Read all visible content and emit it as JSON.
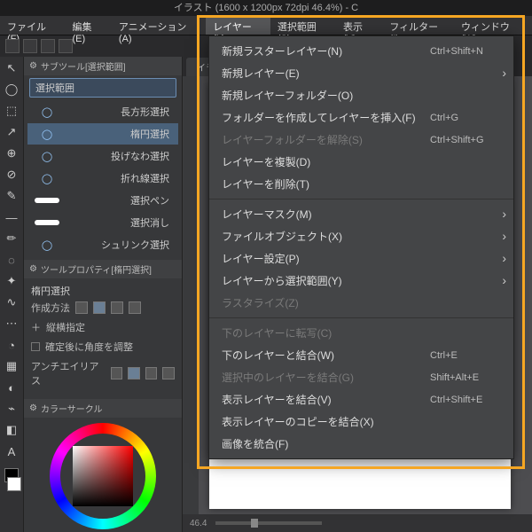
{
  "title": "イラスト (1600 x 1200px 72dpi 46.4%) - C",
  "menubar": [
    {
      "label": "ファイル(F)"
    },
    {
      "label": "編集(E)"
    },
    {
      "label": "アニメーション(A)"
    },
    {
      "label": "レイヤー(L)",
      "active": true
    },
    {
      "label": "選択範囲(S)"
    },
    {
      "label": "表示(V)"
    },
    {
      "label": "フィルター(I)"
    },
    {
      "label": "ウィンドウ(W)"
    }
  ],
  "subtool": {
    "header": "サブツール[選択範囲]",
    "tab": "選択範囲",
    "items": [
      {
        "name": "長方形選択"
      },
      {
        "name": "楕円選択",
        "selected": true
      },
      {
        "name": "投げなわ選択"
      },
      {
        "name": "折れ線選択"
      },
      {
        "name": "選択ペン",
        "wavy": true
      },
      {
        "name": "選択消し",
        "wavy": true
      },
      {
        "name": "シュリンク選択"
      }
    ]
  },
  "toolprop": {
    "header": "ツールプロパティ[楕円選択]",
    "name": "楕円選択",
    "rows": [
      {
        "label": "作成方法",
        "icons": 4
      },
      {
        "label": "縦横指定",
        "prefix": "＋"
      },
      {
        "label": "確定後に角度を調整",
        "check": true
      },
      {
        "label": "アンチエイリアス",
        "icons": 4
      }
    ]
  },
  "colorcircle": {
    "header": "カラーサークル"
  },
  "canvas": {
    "tab": "イラス",
    "zoom": "46.4"
  },
  "dropdown": [
    {
      "label": "新規ラスターレイヤー(N)",
      "shortcut": "Ctrl+Shift+N"
    },
    {
      "label": "新規レイヤー(E)",
      "sub": true
    },
    {
      "label": "新規レイヤーフォルダー(O)"
    },
    {
      "label": "フォルダーを作成してレイヤーを挿入(F)",
      "shortcut": "Ctrl+G"
    },
    {
      "label": "レイヤーフォルダーを解除(S)",
      "shortcut": "Ctrl+Shift+G",
      "disabled": true
    },
    {
      "label": "レイヤーを複製(D)"
    },
    {
      "label": "レイヤーを削除(T)"
    },
    {
      "sep": true
    },
    {
      "label": "レイヤーマスク(M)",
      "sub": true
    },
    {
      "label": "ファイルオブジェクト(X)",
      "sub": true
    },
    {
      "label": "レイヤー設定(P)",
      "sub": true
    },
    {
      "label": "レイヤーから選択範囲(Y)",
      "sub": true
    },
    {
      "label": "ラスタライズ(Z)",
      "disabled": true
    },
    {
      "sep": true
    },
    {
      "label": "下のレイヤーに転写(C)",
      "disabled": true
    },
    {
      "label": "下のレイヤーと結合(W)",
      "shortcut": "Ctrl+E"
    },
    {
      "label": "選択中のレイヤーを結合(G)",
      "shortcut": "Shift+Alt+E",
      "disabled": true
    },
    {
      "label": "表示レイヤーを結合(V)",
      "shortcut": "Ctrl+Shift+E"
    },
    {
      "label": "表示レイヤーのコピーを結合(X)"
    },
    {
      "label": "画像を統合(F)"
    }
  ],
  "tools": [
    "↖",
    "◯",
    "⬚",
    "↗",
    "⊕",
    "⊘",
    "✎",
    "—",
    "✏",
    "◌",
    "✦",
    "∿",
    "⋯",
    "◔",
    "▦",
    "◐",
    "⌁",
    "◧",
    "A"
  ]
}
